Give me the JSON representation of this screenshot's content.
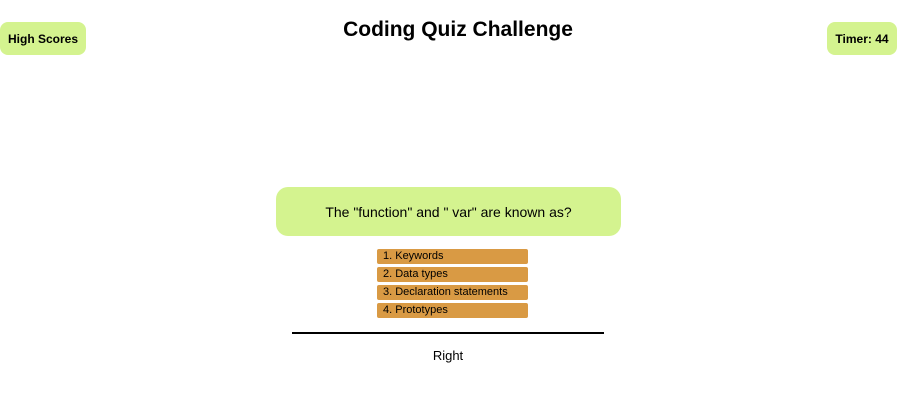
{
  "header": {
    "high_scores_label": "High Scores",
    "title": "Coding Quiz Challenge",
    "timer_label": "Timer: 44"
  },
  "quiz": {
    "question": "The \"function\" and \" var\" are known as?",
    "choices": [
      "1. Keywords",
      "2. Data types",
      "3. Declaration statements",
      "4. Prototypes"
    ],
    "feedback": "Right"
  },
  "colors": {
    "accent_green": "#d4f38f",
    "choice_orange": "#d99a44"
  }
}
